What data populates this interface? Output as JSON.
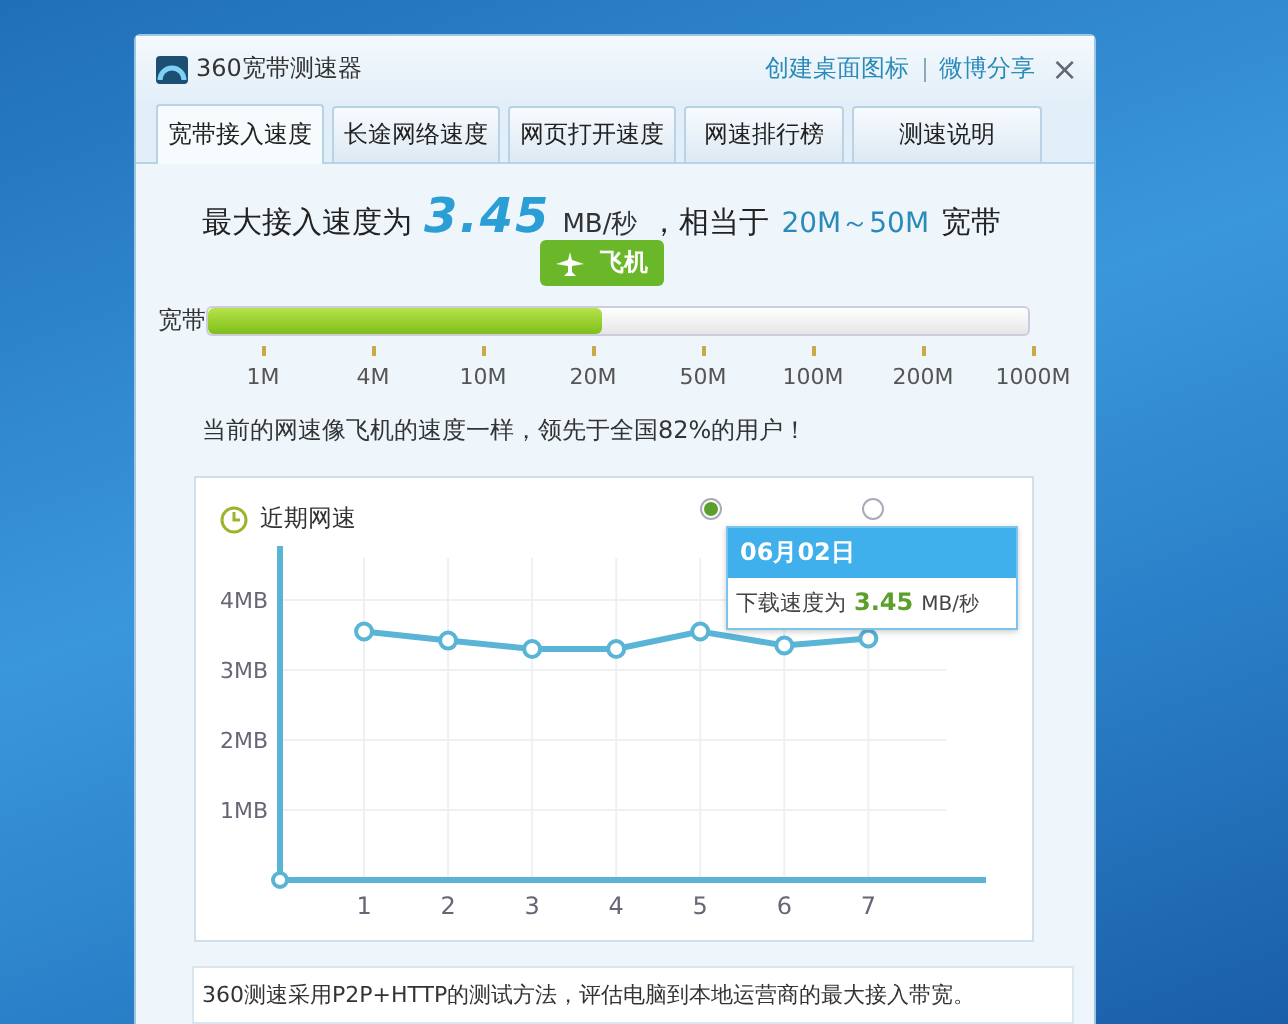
{
  "window": {
    "title": "360宽带测速器",
    "links": [
      "创建桌面图标",
      "微博分享"
    ],
    "close": "×"
  },
  "tabs": [
    {
      "label": "宽带接入速度",
      "selected": true
    },
    {
      "label": "长途网络速度",
      "selected": false
    },
    {
      "label": "网页打开速度",
      "selected": false
    },
    {
      "label": "网速排行榜",
      "selected": false
    },
    {
      "label": "测速说明",
      "selected": false
    }
  ],
  "headline": {
    "prefix": "最大接入速度为",
    "value": "3.45",
    "unit": "MB/秒",
    "middle": "，相当于",
    "range": "20M～50M",
    "suffix": "宽带"
  },
  "speed_bar": {
    "label": "宽带",
    "badge": "飞机",
    "level": 0.48,
    "ticks": [
      "1M",
      "4M",
      "10M",
      "20M",
      "50M",
      "100M",
      "200M",
      "1000M"
    ]
  },
  "summary": "当前的网速像飞机的速度一样，领先于全国82%的用户！",
  "recent": {
    "title": "近期网速",
    "radios": [
      {
        "selected": true
      },
      {
        "selected": false
      }
    ],
    "chart_data": {
      "type": "line",
      "x": [
        1,
        2,
        3,
        4,
        5,
        6,
        7
      ],
      "grid": true,
      "xlim": [
        0,
        8.4
      ],
      "series": [
        {
          "color": "#5ab4d6",
          "marker": true,
          "values": [
            3.55,
            3.42,
            3.3,
            3.3,
            3.55,
            3.35,
            3.45
          ]
        }
      ],
      "ylim": [
        0,
        4.6
      ],
      "yticks": [
        {
          "value": 1,
          "label": "1MB"
        },
        {
          "value": 2,
          "label": "2MB"
        },
        {
          "value": 3,
          "label": "3MB"
        },
        {
          "value": 4,
          "label": "4MB"
        }
      ],
      "xticks": [
        1,
        2,
        3,
        4,
        5,
        6,
        7
      ]
    },
    "tooltip": {
      "date": "06月02日",
      "label": "下载速度为",
      "value": "3.45",
      "unit": "MB/秒"
    }
  },
  "footer": "360测速采用P2P+HTTP的测试方法，评估电脑到本地运营商的最大接入带宽。"
}
